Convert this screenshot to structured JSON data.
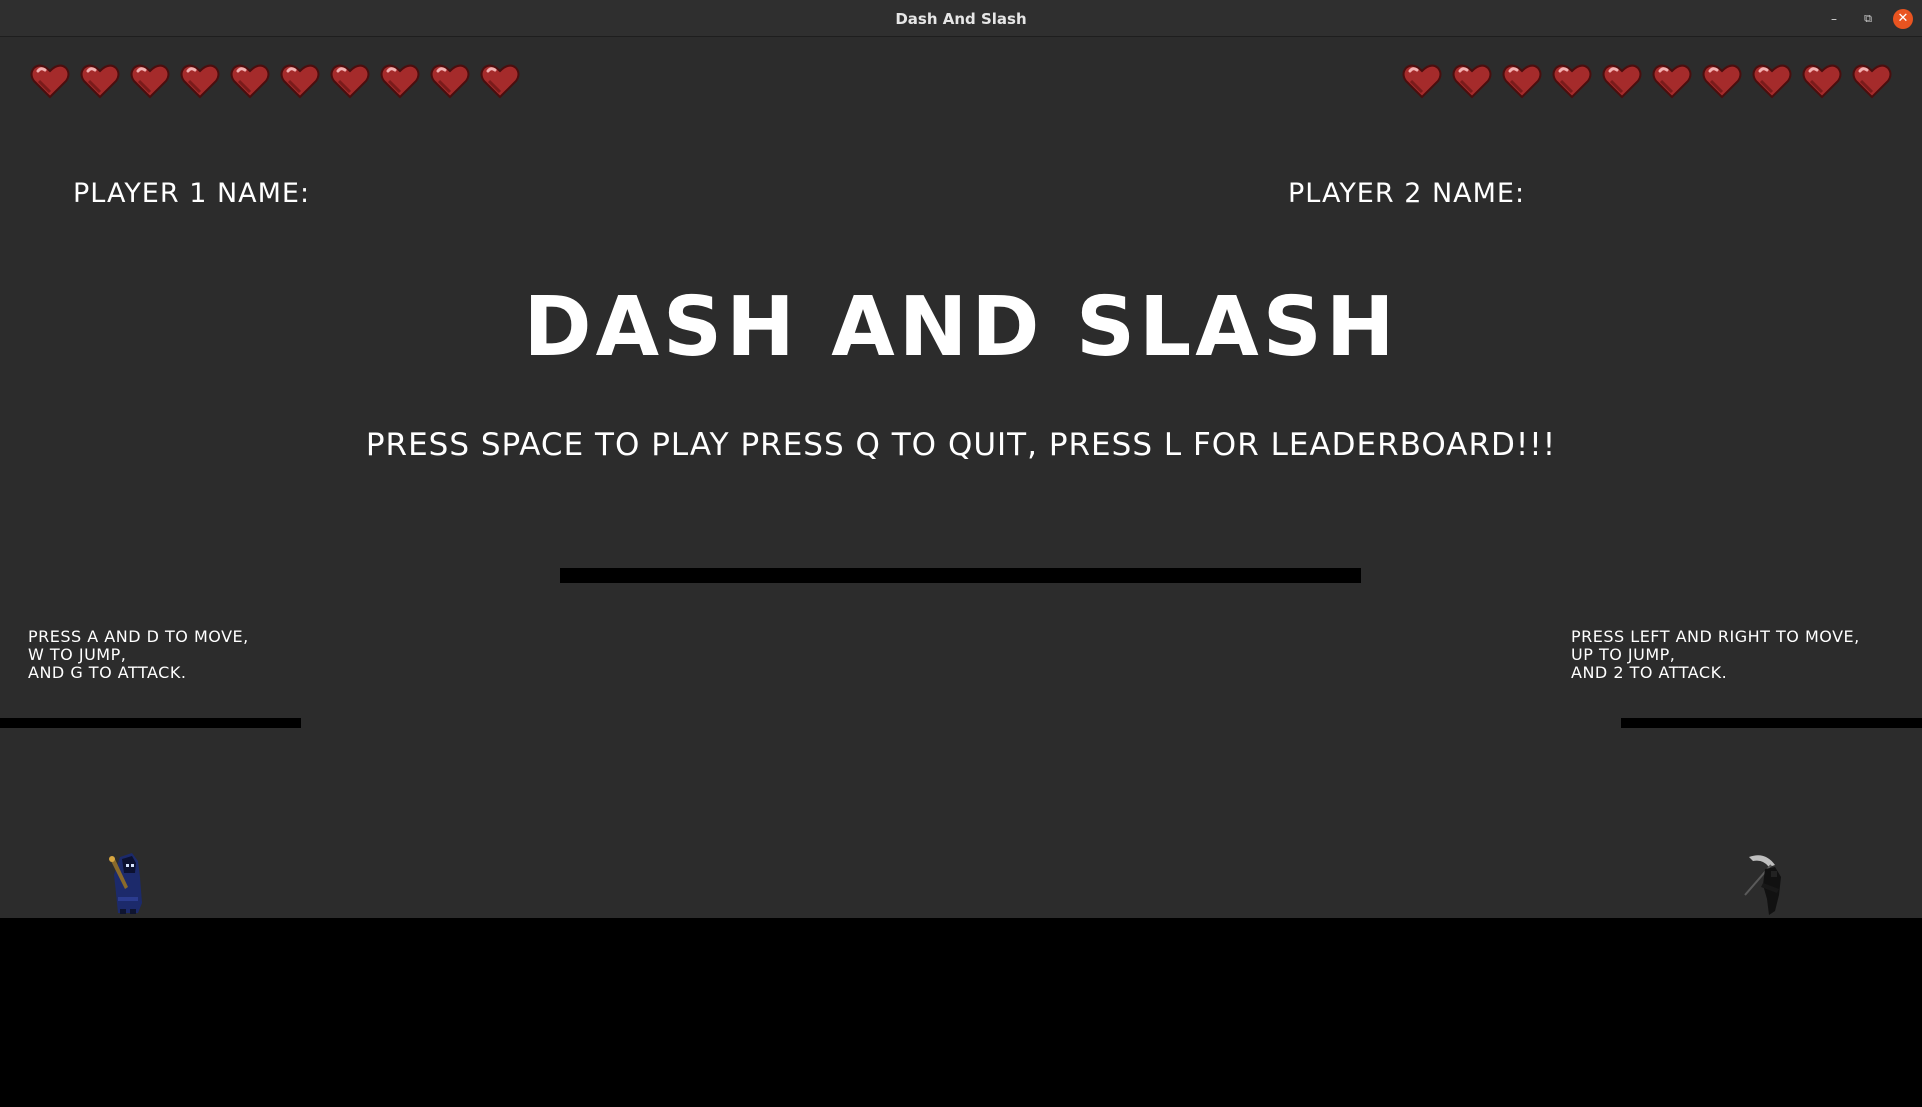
{
  "window": {
    "title": "Dash And Slash"
  },
  "game": {
    "title": "DASH AND SLASH",
    "instructions": "PRESS SPACE TO PLAY PRESS Q TO QUIT, PRESS L FOR LEADERBOARD!!!",
    "player1": {
      "name_label": "PLAYER 1 NAME:",
      "controls": "PRESS A AND D TO MOVE,\nW TO JUMP,\nAND G TO ATTACK.",
      "hearts": 10
    },
    "player2": {
      "name_label": "PLAYER 2 NAME:",
      "controls": "PRESS LEFT AND RIGHT TO MOVE,\nUP TO JUMP,\nAND 2 TO ATTACK.",
      "hearts": 10
    }
  },
  "colors": {
    "background": "#2c2c2c",
    "platform": "#000000",
    "heart": "#a52b2b",
    "close_button": "#e95420"
  },
  "icons": {
    "heart": "heart-icon",
    "minimize": "minimize-icon",
    "maximize": "maximize-icon",
    "close": "close-icon"
  }
}
